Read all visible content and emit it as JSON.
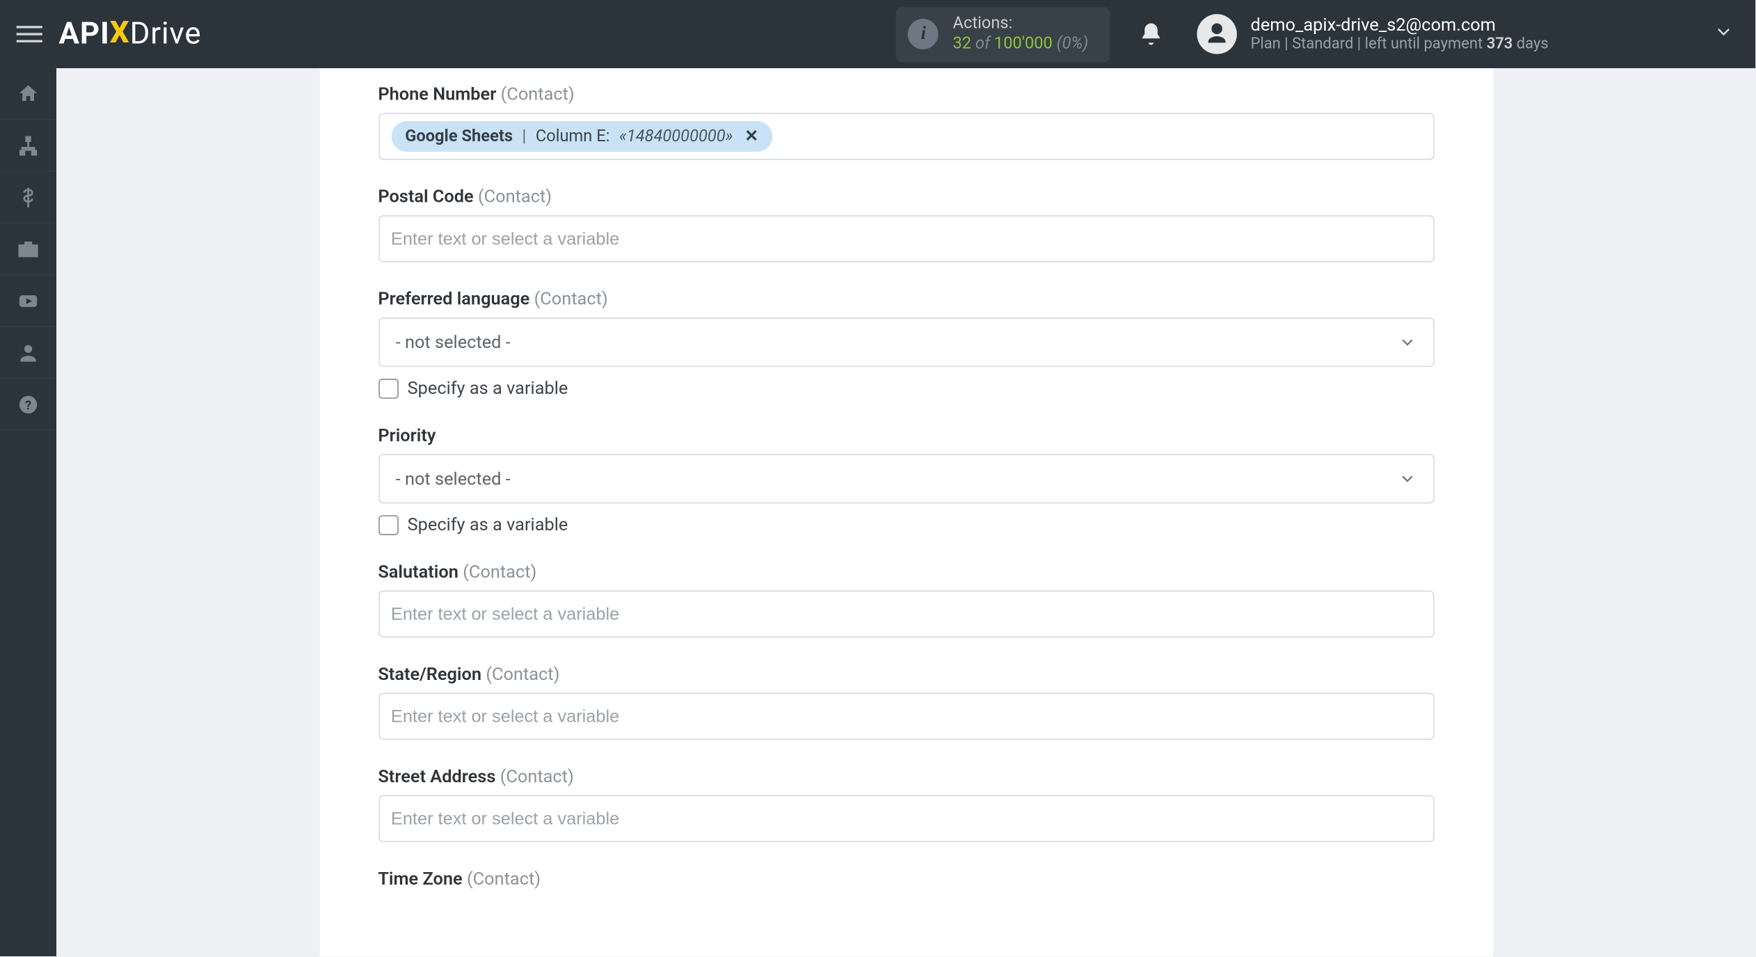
{
  "header": {
    "logo": {
      "api": "API",
      "x": "X",
      "drive": "Drive"
    },
    "actions": {
      "label": "Actions:",
      "used": "32",
      "of": "of",
      "total": "100'000",
      "pct": "(0%)"
    },
    "user": {
      "email": "demo_apix-drive_s2@com.com",
      "plan_prefix": "Plan  | Standard |  left until payment ",
      "days_num": "373",
      "days_suffix": " days"
    }
  },
  "sidebar": {
    "items": [
      {
        "name": "home-icon"
      },
      {
        "name": "sitemap-icon"
      },
      {
        "name": "dollar-icon"
      },
      {
        "name": "briefcase-icon"
      },
      {
        "name": "youtube-icon"
      },
      {
        "name": "user-icon"
      },
      {
        "name": "help-icon"
      }
    ]
  },
  "form": {
    "placeholder_text": "Enter text or select a variable",
    "not_selected": "- not selected -",
    "specify_variable": "Specify as a variable",
    "fields": [
      {
        "label": "Phone Number",
        "hint": "(Contact)",
        "type": "chips",
        "chips": [
          {
            "source": "Google Sheets",
            "sep": " | ",
            "desc": "Column E: ",
            "value": "«14840000000»"
          }
        ]
      },
      {
        "label": "Postal Code",
        "hint": "(Contact)",
        "type": "text"
      },
      {
        "label": "Preferred language",
        "hint": "(Contact)",
        "type": "select_checkbox"
      },
      {
        "label": "Priority",
        "hint": "",
        "type": "select_checkbox"
      },
      {
        "label": "Salutation",
        "hint": "(Contact)",
        "type": "text"
      },
      {
        "label": "State/Region",
        "hint": "(Contact)",
        "type": "text"
      },
      {
        "label": "Street Address",
        "hint": "(Contact)",
        "type": "text"
      },
      {
        "label": "Time Zone",
        "hint": "(Contact)",
        "type": "label_only"
      }
    ]
  }
}
